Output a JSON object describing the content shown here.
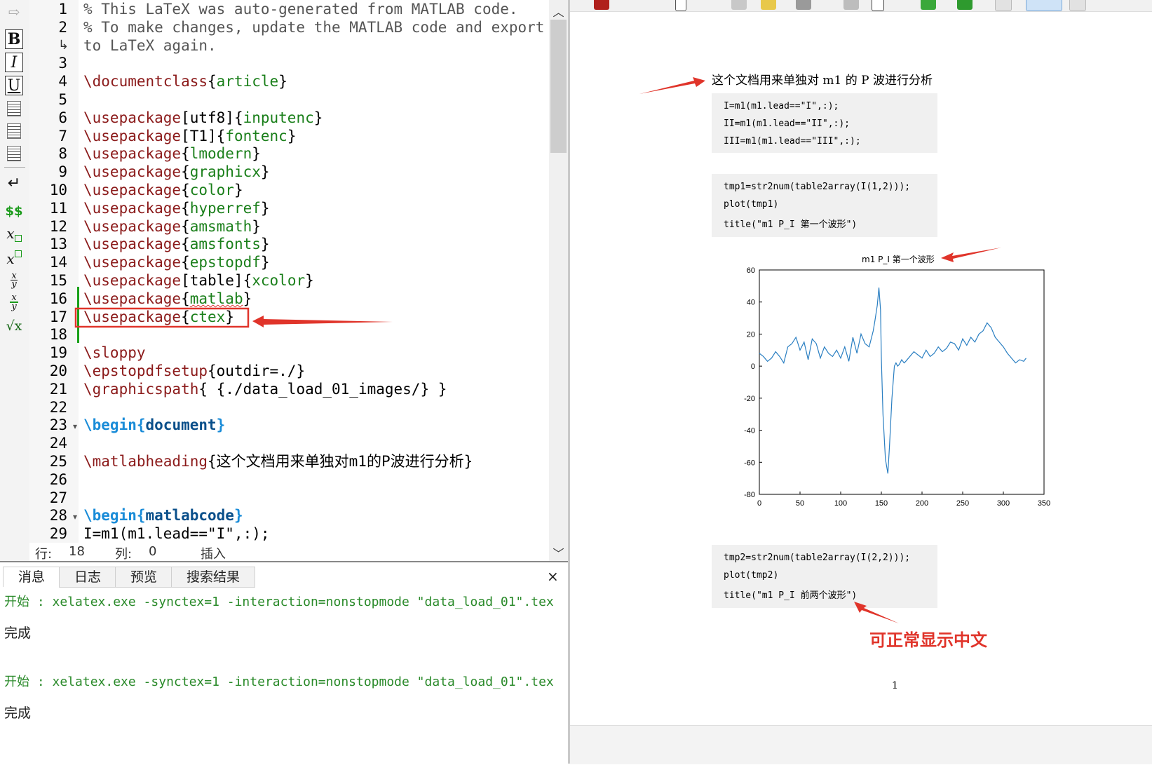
{
  "editor": {
    "line_numbers": [
      "1",
      "2",
      "",
      "3",
      "4",
      "5",
      "6",
      "7",
      "8",
      "9",
      "10",
      "11",
      "12",
      "13",
      "14",
      "15",
      "16",
      "17",
      "18",
      "19",
      "20",
      "21",
      "22",
      "23",
      "24",
      "25",
      "26",
      "27",
      "28",
      "29"
    ],
    "lines": [
      {
        "comment": "% This LaTeX was auto-generated from MATLAB code."
      },
      {
        "comment": "% To make changes, update the MATLAB code and export"
      },
      {
        "comment": "to LaTeX again."
      },
      {},
      {
        "cmd": "\\documentclass",
        "arg": "article"
      },
      {},
      {
        "cmd": "\\usepackage",
        "opt": "[utf8]",
        "arg": "inputenc"
      },
      {
        "cmd": "\\usepackage",
        "opt": "[T1]",
        "arg": "fontenc"
      },
      {
        "cmd": "\\usepackage",
        "arg": "lmodern"
      },
      {
        "cmd": "\\usepackage",
        "arg": "graphicx"
      },
      {
        "cmd": "\\usepackage",
        "arg": "color"
      },
      {
        "cmd": "\\usepackage",
        "arg": "hyperref"
      },
      {
        "cmd": "\\usepackage",
        "arg": "amsmath"
      },
      {
        "cmd": "\\usepackage",
        "arg": "amsfonts"
      },
      {
        "cmd": "\\usepackage",
        "arg": "epstopdf"
      },
      {
        "cmd": "\\usepackage",
        "opt": "[table]",
        "arg": "xcolor"
      },
      {
        "cmd": "\\usepackage",
        "arg": "matlab"
      },
      {
        "cmd": "\\usepackage",
        "arg": "ctex"
      },
      {},
      {
        "cmd": "\\sloppy"
      },
      {
        "cmd": "\\epstopdfsetup",
        "plain": "{outdir=./}"
      },
      {
        "cmd": "\\graphicspath",
        "plain": "{ {./data_load_01_images/} }"
      },
      {},
      {
        "env": "\\begin",
        "envname": "document"
      },
      {},
      {
        "cmd": "\\matlabheading",
        "plain": "{这个文档用来单独对m1的P波进行分析}"
      },
      {},
      {},
      {
        "env": "\\begin",
        "envname": "matlabcode"
      },
      {
        "plain": "I=m1(m1.lead==\"I\",:);"
      }
    ],
    "status": {
      "row_label": "行:",
      "row_value": "18",
      "col_label": "列:",
      "col_value": "0",
      "mode": "插入"
    }
  },
  "toolbar_left": {
    "bold": "B",
    "italic": "I",
    "underline": "U",
    "math": "$$",
    "sub": "x",
    "sup": "x",
    "frac_num": "x",
    "frac_den": "y",
    "sqrt": "√x"
  },
  "messages": {
    "tabs": [
      "消息",
      "日志",
      "预览",
      "搜索结果"
    ],
    "close": "×",
    "entries": [
      {
        "text": "开始 : xelatex.exe -synctex=1 -interaction=nonstopmode \"data_load_01\".tex",
        "kind": "green"
      },
      {
        "text": "完成",
        "kind": "plain"
      },
      {
        "text": "开始 : xelatex.exe -synctex=1 -interaction=nonstopmode \"data_load_01\".tex",
        "kind": "green"
      },
      {
        "text": "完成",
        "kind": "plain"
      }
    ]
  },
  "pdf": {
    "heading": "这个文档用来单独对 m1 的 P 波进行分析",
    "code_blocks": [
      [
        "I=m1(m1.lead==\"I\",:);",
        "II=m1(m1.lead==\"II\",:);",
        "III=m1(m1.lead==\"III\",:);"
      ],
      [
        "tmp1=str2num(table2array(I(1,2)));",
        "plot(tmp1)",
        "title(\"m1 P_I 第一个波形\")"
      ],
      [
        "tmp2=str2num(table2array(I(2,2)));",
        "plot(tmp2)",
        "title(\"m1 P_I 前两个波形\")"
      ]
    ],
    "page_number": "1",
    "annotation": "可正常显示中文"
  },
  "chart_data": {
    "type": "line",
    "title": "m1 P_I 第一个波形",
    "xlim": [
      0,
      350
    ],
    "ylim": [
      -80,
      60
    ],
    "xticks": [
      0,
      50,
      100,
      150,
      200,
      250,
      300,
      350
    ],
    "yticks": [
      60,
      40,
      20,
      0,
      -20,
      -40,
      -60,
      -80
    ],
    "line_color": "#2a7fc2",
    "x": [
      0,
      5,
      10,
      15,
      20,
      25,
      30,
      35,
      40,
      45,
      50,
      55,
      60,
      65,
      70,
      75,
      80,
      85,
      90,
      95,
      100,
      105,
      110,
      115,
      120,
      125,
      130,
      135,
      140,
      142,
      145,
      147,
      149,
      150,
      152,
      155,
      158,
      160,
      163,
      166,
      168,
      170,
      172,
      175,
      178,
      180,
      185,
      190,
      195,
      200,
      205,
      210,
      215,
      220,
      225,
      230,
      235,
      240,
      245,
      250,
      255,
      260,
      265,
      270,
      275,
      280,
      285,
      290,
      295,
      300,
      305,
      310,
      315,
      320,
      325,
      328
    ],
    "y": [
      8,
      6,
      3,
      5,
      9,
      6,
      2,
      12,
      14,
      18,
      10,
      15,
      4,
      17,
      14,
      5,
      12,
      8,
      6,
      10,
      5,
      12,
      3,
      18,
      8,
      20,
      14,
      12,
      22,
      28,
      38,
      49,
      35,
      5,
      -30,
      -58,
      -67,
      -50,
      -20,
      0,
      2,
      0,
      1,
      4,
      2,
      3,
      6,
      9,
      7,
      5,
      10,
      6,
      8,
      12,
      9,
      11,
      15,
      14,
      10,
      17,
      13,
      18,
      15,
      20,
      22,
      27,
      24,
      18,
      15,
      12,
      8,
      5,
      2,
      4,
      3,
      5
    ]
  }
}
